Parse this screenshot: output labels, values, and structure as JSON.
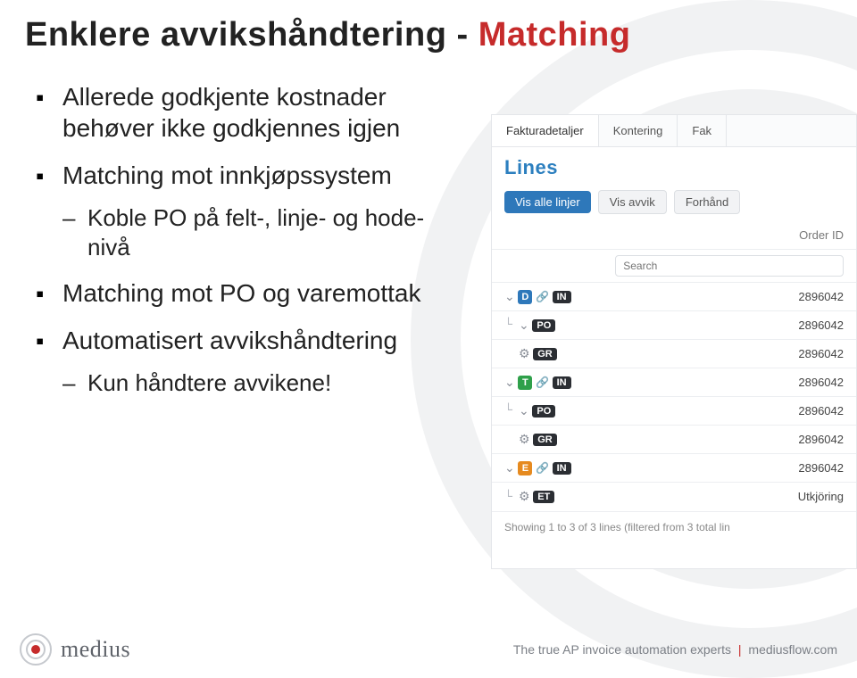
{
  "title": {
    "plain": "Enklere avvikshåndtering -",
    "accent": "Matching"
  },
  "bullets": {
    "b0": {
      "text": "Allerede godkjente kostnader behøver ikke godkjennes igjen"
    },
    "b1": {
      "text": "Matching mot innkjøpssystem",
      "sub0": "Koble PO på felt-, linje- og hode-nivå"
    },
    "b2": {
      "text": "Matching mot PO og varemottak"
    },
    "b3": {
      "text": "Automatisert avvikshåndtering",
      "sub0": "Kun håndtere avvikene!"
    }
  },
  "panel": {
    "tabs": {
      "t0": "Fakturadetaljer",
      "t1": "Kontering",
      "t2": "Fak"
    },
    "section_title": "Lines",
    "buttons": {
      "view_all": "Vis alle linjer",
      "view_dev": "Vis avvik",
      "preview": "Forhånd"
    },
    "th_icons": "",
    "th_order": "Order ID",
    "search_placeholder": "Search",
    "rows": [
      {
        "icons": {
          "caret": "⌄",
          "sq": "D",
          "link": "✎",
          "chip": "IN"
        },
        "order_id": "2896042"
      },
      {
        "icons": {
          "tree": "└",
          "caret": "⌄",
          "chip": "PO"
        },
        "order_id": "2896042"
      },
      {
        "icons": {
          "tree": " ",
          "gear": true,
          "chip": "GR"
        },
        "order_id": "2896042"
      },
      {
        "icons": {
          "caret": "⌄",
          "sq": "T",
          "link": "✎",
          "chip": "IN"
        },
        "order_id": "2896042"
      },
      {
        "icons": {
          "tree": "└",
          "caret": "⌄",
          "chip": "PO"
        },
        "order_id": "2896042"
      },
      {
        "icons": {
          "tree": " ",
          "gear": true,
          "chip": "GR"
        },
        "order_id": "2896042"
      },
      {
        "icons": {
          "caret": "⌄",
          "sq": "E",
          "link": "✎",
          "chip": "IN"
        },
        "order_id": "2896042"
      },
      {
        "icons": {
          "tree": "└",
          "gear": true,
          "chip": "ET"
        },
        "order_id": "Utkjöring"
      }
    ],
    "footer_note": "Showing 1 to 3 of 3 lines (filtered from 3 total lin"
  },
  "footer": {
    "brand": "medius",
    "tag_a": "The true AP invoice automation experts",
    "tag_b": "mediusflow.com"
  }
}
